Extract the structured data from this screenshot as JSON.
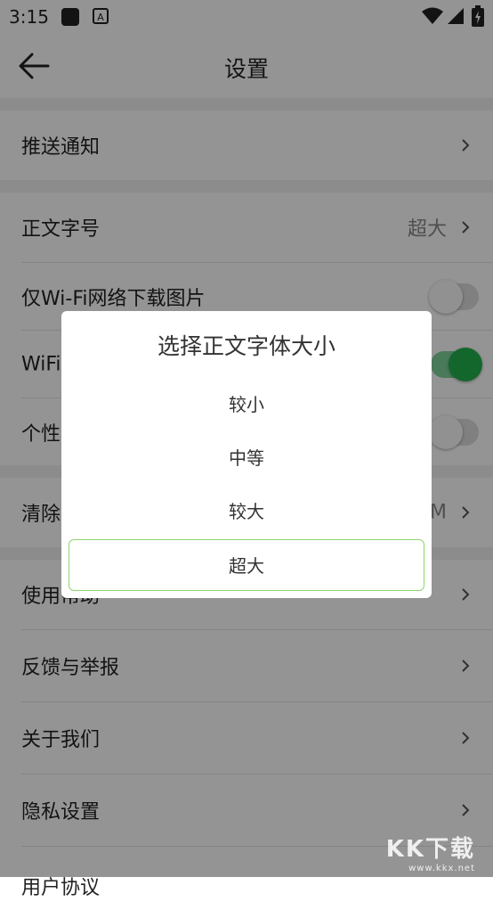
{
  "status_bar": {
    "time": "3:15"
  },
  "app_bar": {
    "title": "设置"
  },
  "settings": {
    "push": {
      "label": "推送通知"
    },
    "font_size": {
      "label": "正文字号",
      "value": "超大"
    },
    "wifi_images": {
      "label": "仅Wi-Fi网络下载图片",
      "on": false
    },
    "wifi_video": {
      "label": "WiFi",
      "on": true
    },
    "personal": {
      "label": "个性",
      "on": false
    },
    "clear_cache": {
      "label": "清除",
      "value": "M"
    },
    "help": {
      "label": "使用帮助"
    },
    "feedback": {
      "label": "反馈与举报"
    },
    "about": {
      "label": "关于我们"
    },
    "privacy": {
      "label": "隐私设置"
    },
    "user_agreement": {
      "label": "用户协议"
    }
  },
  "dialog": {
    "title": "选择正文字体大小",
    "options": [
      "较小",
      "中等",
      "较大",
      "超大"
    ],
    "selected": "超大"
  },
  "watermark": {
    "text": "KK下载",
    "url": "www.kkx.net"
  },
  "colors": {
    "accent": "#22b14c",
    "selected_border": "#8fd46f"
  }
}
